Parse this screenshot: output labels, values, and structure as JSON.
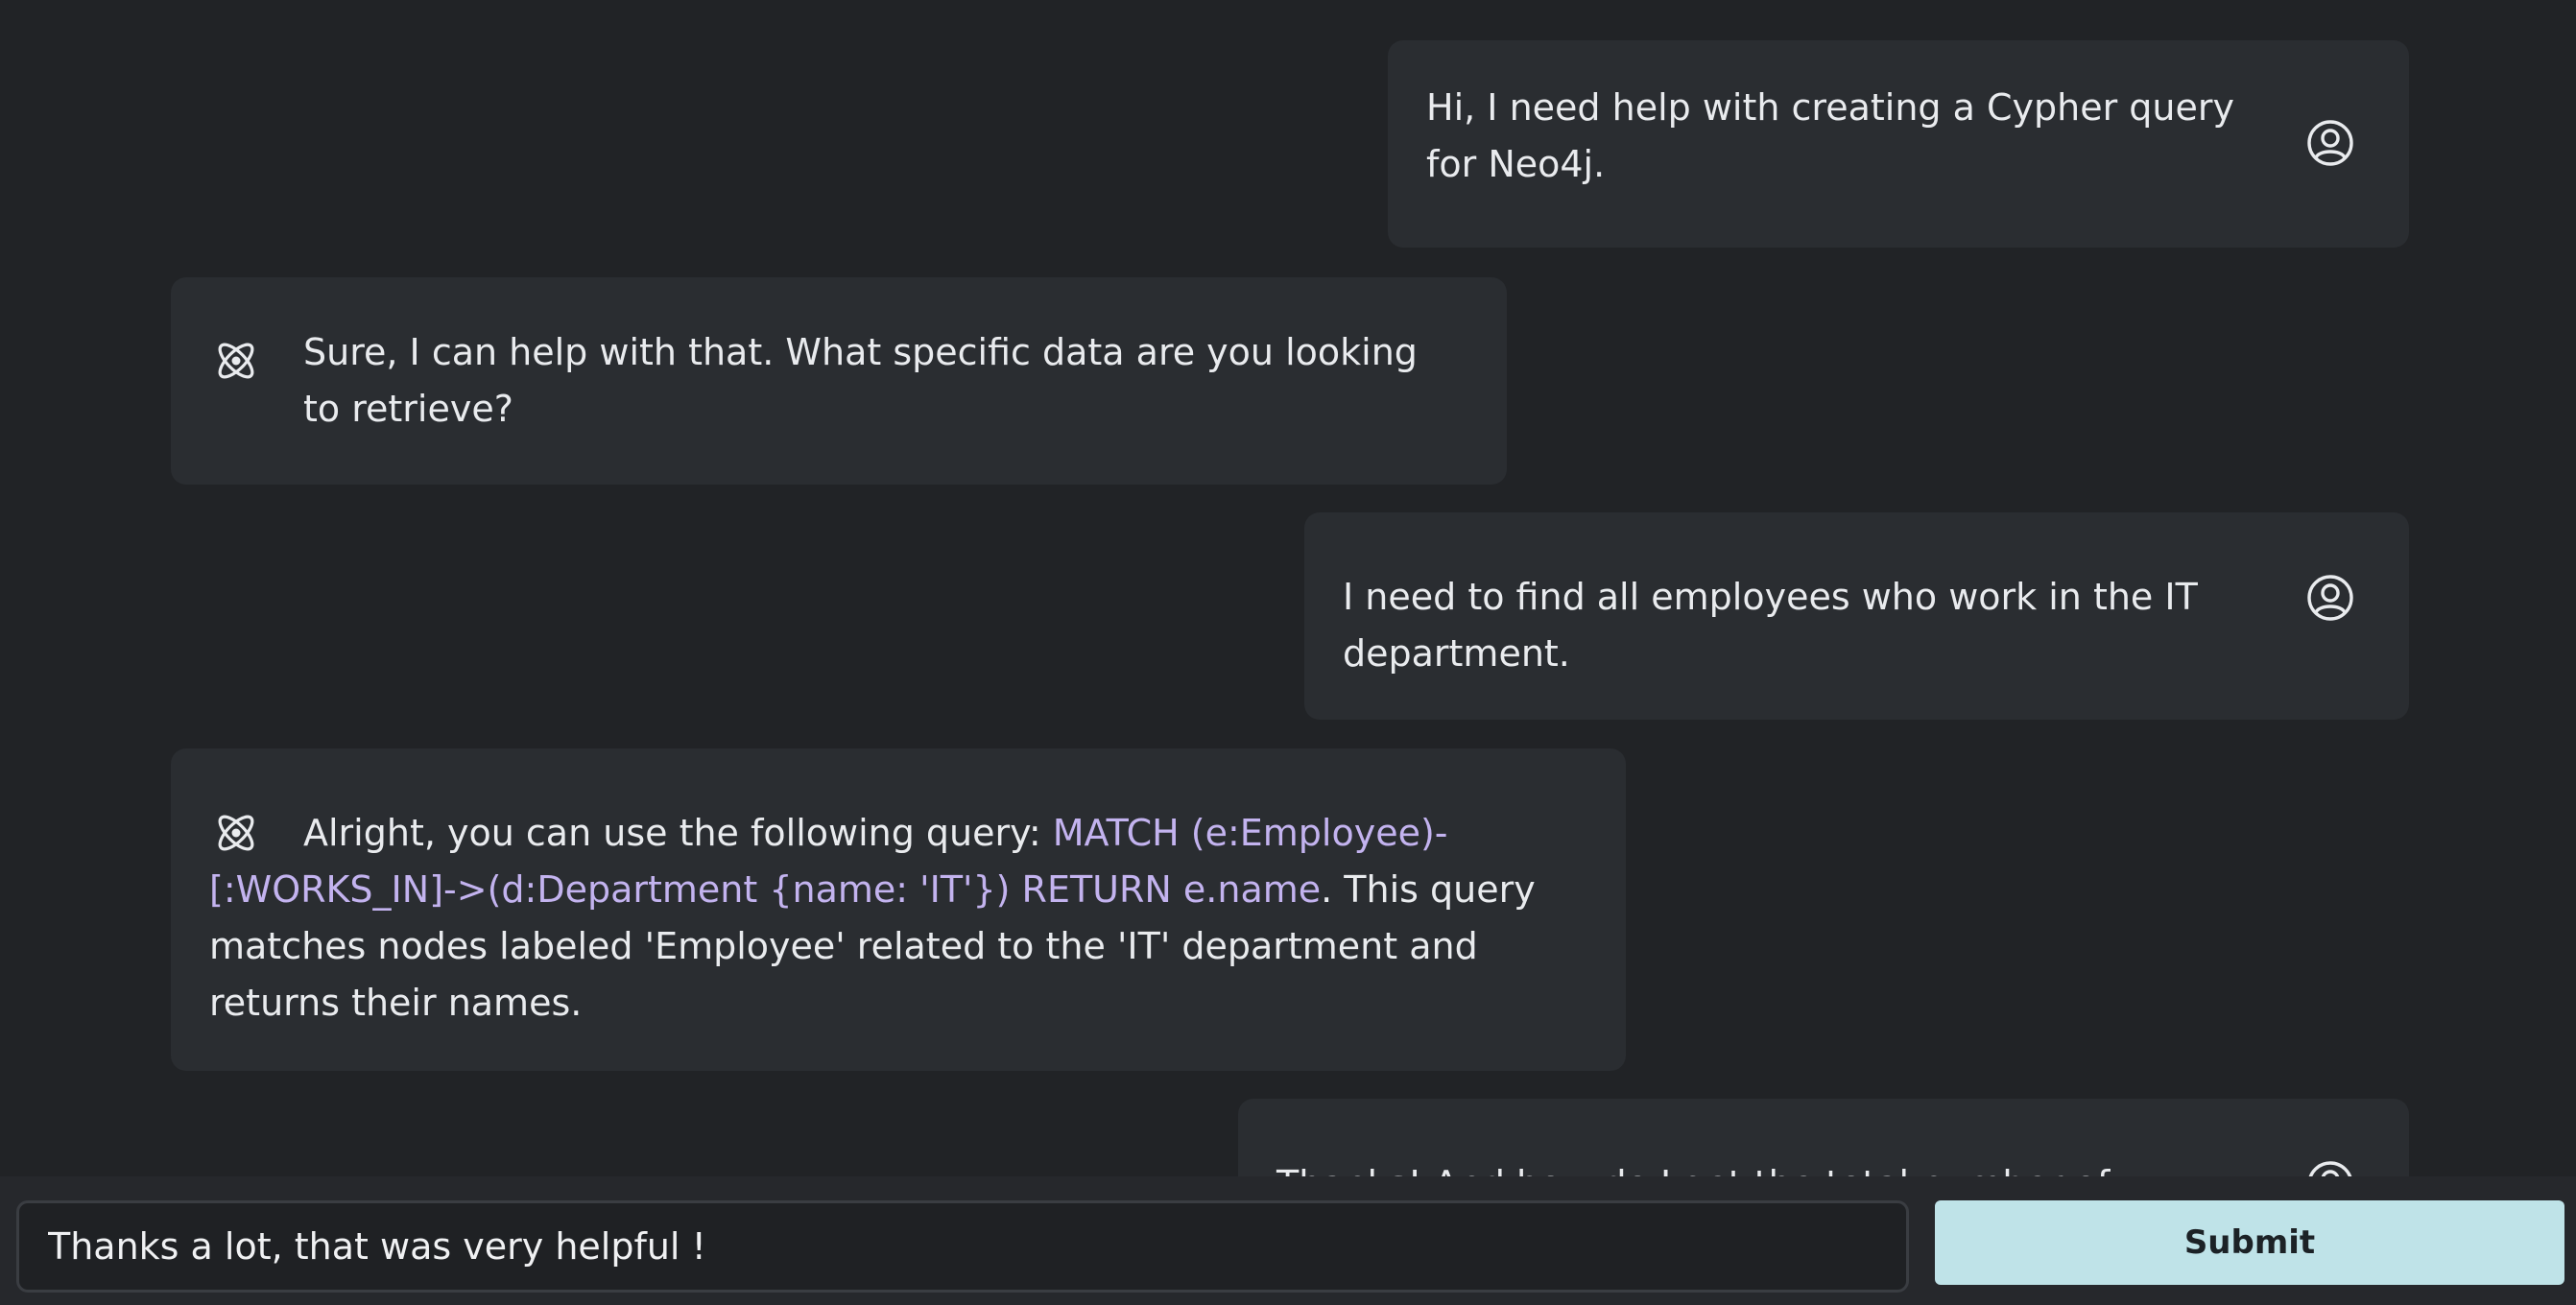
{
  "messages": [
    {
      "role": "user",
      "text": "Hi, I need help with creating a Cypher query for Neo4j."
    },
    {
      "role": "assistant",
      "text": "Sure, I can help with that. What specific data are you looking to retrieve?"
    },
    {
      "role": "user",
      "text": "I need to find all employees who work in the IT department."
    },
    {
      "role": "assistant",
      "text_before": "Alright, you can use the following query: ",
      "code": "MATCH (e:Employee)-[:WORKS_IN]->(d:Department {name: 'IT'}) RETURN e.name",
      "text_after": ". This query matches nodes labeled 'Employee' related to the 'IT' department and returns their names."
    },
    {
      "role": "user",
      "text": "Thanks! And how do I get the total number of employees"
    }
  ],
  "composer": {
    "value": "Thanks a lot, that was very helpful !",
    "submit_label": "Submit"
  },
  "icons": {
    "user": "user-circle-icon",
    "assistant": "atom-icon"
  },
  "colors": {
    "background": "#212326",
    "bubble": "#2a2d31",
    "code": "#c3b3ef",
    "submit": "#bfe3e8"
  }
}
